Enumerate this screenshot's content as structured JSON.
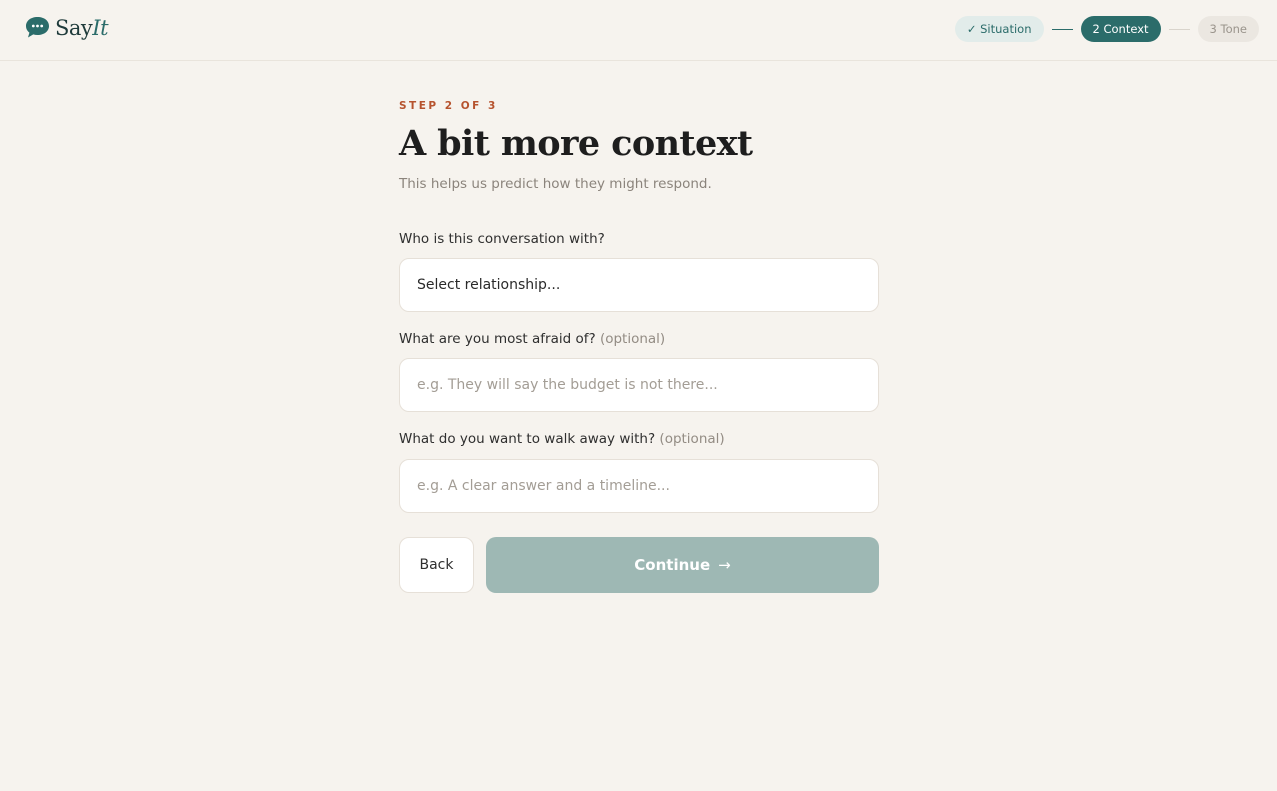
{
  "app": {
    "name_part1": "Say",
    "name_part2": "It",
    "brand_color": "#2b6c6a"
  },
  "stepper": {
    "steps": [
      {
        "label": "✓ Situation",
        "state": "done"
      },
      {
        "label": "2 Context",
        "state": "active"
      },
      {
        "label": "3 Tone",
        "state": "todo"
      }
    ]
  },
  "page": {
    "eyebrow": "STEP 2 OF 3",
    "title": "A bit more context",
    "subtitle": "This helps us predict how they might respond."
  },
  "form": {
    "relationship": {
      "label": "Who is this conversation with?",
      "selected": "Select relationship..."
    },
    "fear": {
      "label": "What are you most afraid of?",
      "optional": "(optional)",
      "value": "",
      "placeholder": "e.g. They will say the budget is not there..."
    },
    "goal": {
      "label": "What do you want to walk away with?",
      "optional": "(optional)",
      "value": "",
      "placeholder": "e.g. A clear answer and a timeline..."
    }
  },
  "actions": {
    "back_label": "Back",
    "continue_label": "Continue",
    "continue_arrow": "→"
  }
}
